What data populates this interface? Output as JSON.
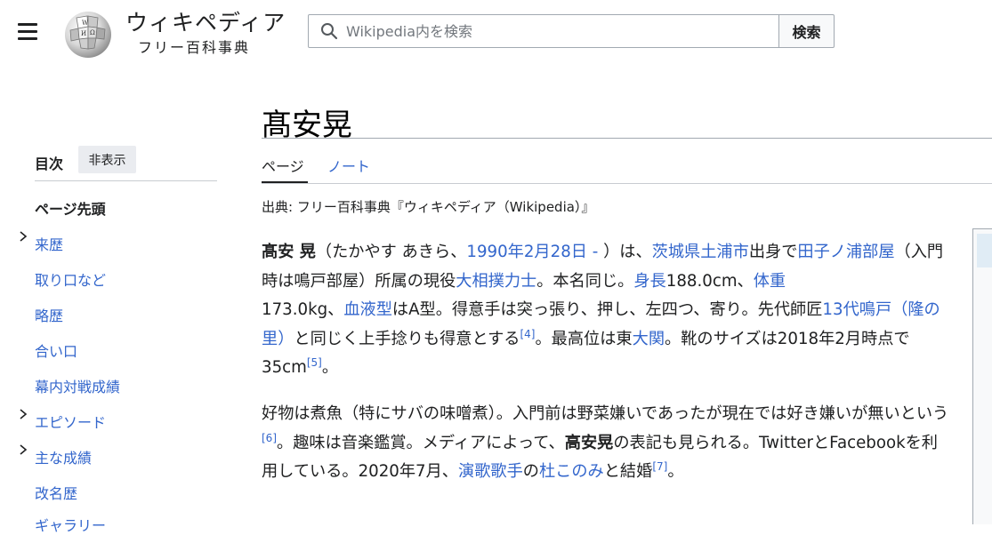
{
  "header": {
    "wordmark": "ウィキペディア",
    "tagline": "フリー百科事典",
    "search": {
      "placeholder": "Wikipedia内を検索",
      "button_label": "検索"
    }
  },
  "sidebar": {
    "toc_title": "目次",
    "toc_hide_label": "非表示",
    "toc_top": "ページ先頭",
    "items": [
      {
        "label": "来歴",
        "expandable": true
      },
      {
        "label": "取り口など",
        "expandable": false
      },
      {
        "label": "略歴",
        "expandable": false
      },
      {
        "label": "合い口",
        "expandable": false
      },
      {
        "label": "幕内対戦成績",
        "expandable": false
      },
      {
        "label": "エピソード",
        "expandable": true
      },
      {
        "label": "主な成績",
        "expandable": true
      },
      {
        "label": "改名歴",
        "expandable": false
      }
    ],
    "cut_off_item": "ギャラリー"
  },
  "article": {
    "title": "髙安晃",
    "tabs": [
      {
        "label": "ページ",
        "active": true
      },
      {
        "label": "ノート",
        "active": false
      }
    ],
    "source": "出典: フリー百科事典『ウィキペディア（Wikipedia）』",
    "p1": {
      "name_bold": "髙安 晃",
      "t1": "（たかやす あきら、",
      "birth_link": "1990年2月28日 -",
      "t2": " ）は、",
      "place_link": "茨城県土浦市",
      "t3": "出身で",
      "stable_link": "田子ノ浦部屋",
      "t4": "（入門時は鳴戸部屋）所属の現役",
      "rikishi_link": "大相撲力士",
      "t5": "。本名同じ。",
      "height_link": "身長",
      "t6": "188.0cm、",
      "weight_link": "体重",
      "t7": "173.0kg、",
      "blood_link": "血液型",
      "t8": "はA型。得意手は突っ張り、押し、左四つ、寄り。先代師匠",
      "master_link": "13代鳴戸（隆の里）",
      "t9": "と同じく上手捻りも得意とする",
      "ref4": "[4]",
      "t10": "。最高位は東",
      "ozeki_link": "大関",
      "t11": "。靴のサイズは2018年2月時点で35cm",
      "ref5": "[5]",
      "t12": "。"
    },
    "p2": {
      "t1": "好物は煮魚（特にサバの味噌煮）。入門前は野菜嫌いであったが現在では好き嫌いが無いという",
      "ref6": "[6]",
      "t2": "。趣味は音楽鑑賞。メディアによって、",
      "name_bold": "高安晃",
      "t3": "の表記も見られる。TwitterとFacebookを利用している。2020年7月、",
      "singer_link": "演歌歌手",
      "t4": "の",
      "spouse_link": "杜このみ",
      "t5": "と結婚",
      "ref7": "[7]",
      "t6": "。"
    }
  },
  "colors": {
    "link": "#3366cc",
    "text": "#202122",
    "border": "#a2a9b1"
  }
}
